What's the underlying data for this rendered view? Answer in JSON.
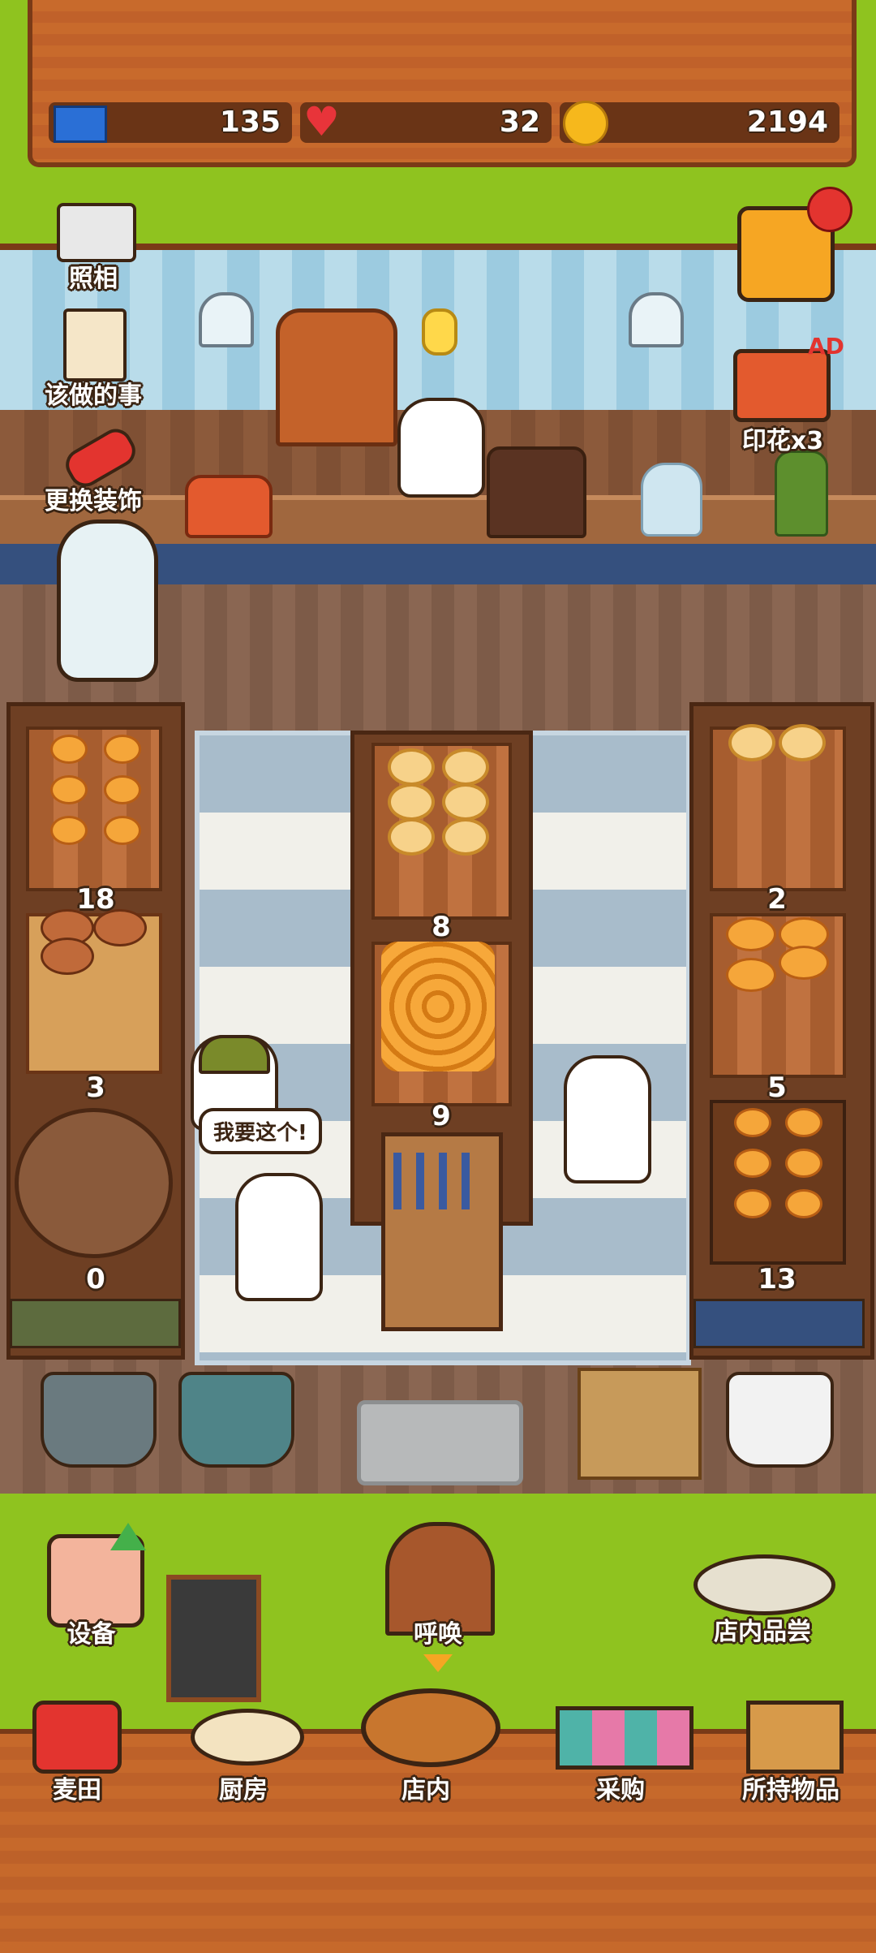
{
  "stats": {
    "tickets": "135",
    "hearts": "32",
    "coins": "2194"
  },
  "side_buttons": {
    "camera": "照相",
    "todo": "该做的事",
    "decor": "更换装饰",
    "stamps": "印花x3",
    "ad_badge": "AD"
  },
  "shelf_counts": {
    "left_top": "18",
    "left_mid": "3",
    "left_bottom": "0",
    "center_top": "8",
    "center_bottom": "9",
    "right_top": "2",
    "right_mid": "5",
    "right_bottom": "13"
  },
  "speech": "我要这个!",
  "actions": {
    "equipment": "设备",
    "call": "呼唤",
    "tasting": "店内品尝"
  },
  "nav": {
    "field": "麦田",
    "kitchen": "厨房",
    "store": "店内",
    "purchase": "采购",
    "inventory": "所持物品"
  },
  "colors": {
    "grass": "#8fc31f",
    "wood": "#c6692b",
    "counter_strip": "#35507e"
  }
}
